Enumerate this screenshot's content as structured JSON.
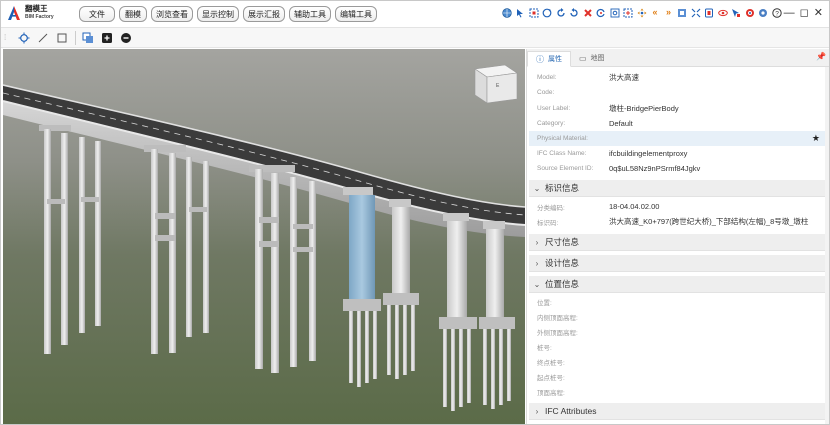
{
  "logo": {
    "name_cn": "翻模王",
    "name_en": "BIM Factory"
  },
  "menu": [
    "文件",
    "翻模",
    "浏览查看",
    "显示控制",
    "展示汇报",
    "辅助工具",
    "编辑工具"
  ],
  "toolbar_icons": [
    "globe-icon",
    "select-arrow-icon",
    "fit-icon",
    "orbit-icon",
    "rotate-left-icon",
    "rotate-right-icon",
    "close-x-icon",
    "refresh-icon",
    "zoom-window-icon",
    "zoom-icon",
    "pan-icon",
    "prev-icon",
    "next-icon",
    "section-box-icon",
    "explode-icon",
    "hide-icon",
    "eye-icon",
    "marker-icon",
    "measure-icon",
    "settings-icon",
    "help-icon"
  ],
  "window_controls": [
    "—",
    "◻",
    "✕"
  ],
  "panel": {
    "tab_properties": "属性",
    "tab_map": "地图",
    "rows": [
      {
        "key": "Model:",
        "value": "洪大高速"
      },
      {
        "key": "Code:",
        "value": ""
      },
      {
        "key": "User Label:",
        "value": "墩柱-BridgePierBody"
      },
      {
        "key": "Category:",
        "value": "Default"
      },
      {
        "key": "Physical Material:",
        "value": ""
      },
      {
        "key": "IFC Class Name:",
        "value": "ifcbuildingelementproxy"
      },
      {
        "key": "Source Element ID:",
        "value": "0q$uL58Nz9nPSrmf84Jgkv"
      }
    ],
    "sec_ident": "标识信息",
    "ident_rows": [
      {
        "key": "分类编码:",
        "value": "18-04.04.02.00"
      },
      {
        "key": "标识码:",
        "value": "洪大高速_K0+797(跨世纪大桥)_下部结构(左幅)_8号墩_墩柱"
      }
    ],
    "sec_size": "尺寸信息",
    "sec_design": "设计信息",
    "sec_pos": "位置信息",
    "pos_rows": [
      "位置:",
      "内侧顶面高程:",
      "外侧顶面高程:",
      "桩号:",
      "终点桩号:",
      "起点桩号:",
      "顶面高程:"
    ],
    "sec_ifc": "IFC Attributes"
  },
  "viewcube": {
    "face": "E"
  },
  "colors": {
    "accent": "#2a6ab3",
    "selected_pier": "#8fb4cf",
    "deck": "#3b3b3b"
  }
}
